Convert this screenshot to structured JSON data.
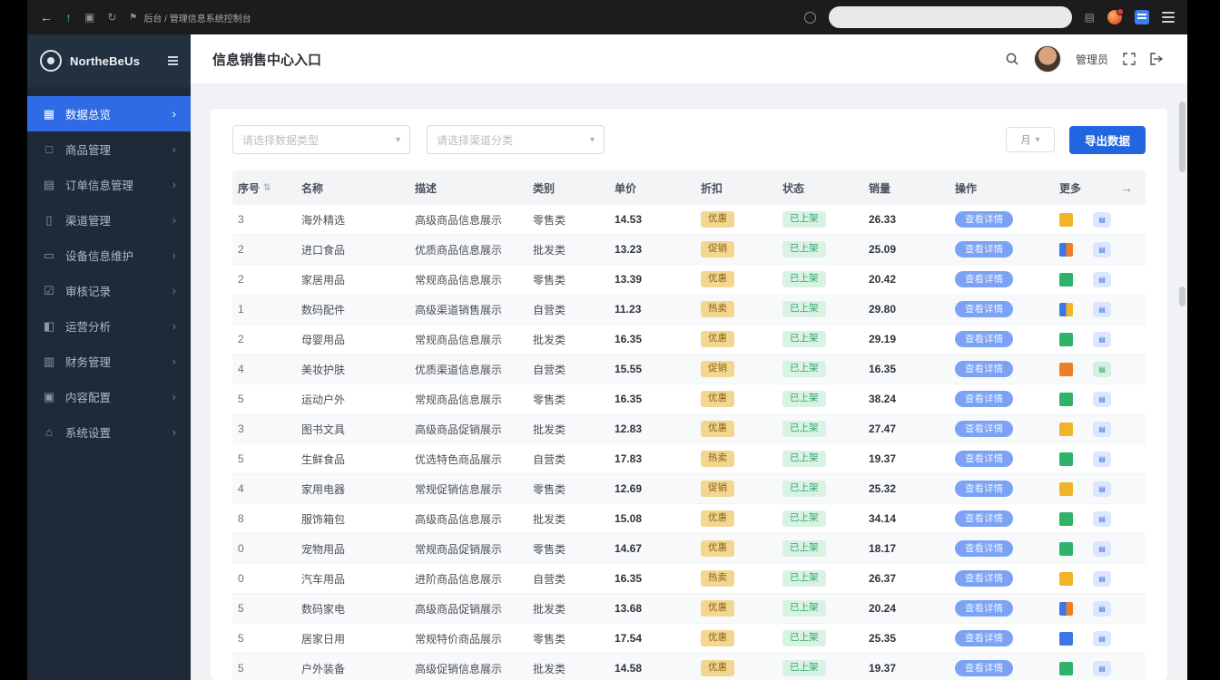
{
  "browser": {
    "address_text": "后台 / 管理信息系统控制台"
  },
  "sidebar": {
    "brand": "NortheBeUs",
    "items": [
      {
        "label": "数据总览",
        "icon": "dashboard-icon",
        "glyph": "▦",
        "active": true
      },
      {
        "label": "商品管理",
        "icon": "products-icon",
        "glyph": "□",
        "active": false
      },
      {
        "label": "订单信息管理",
        "icon": "orders-icon",
        "glyph": "▤",
        "active": false
      },
      {
        "label": "渠道管理",
        "icon": "channel-icon",
        "glyph": "▯",
        "active": false
      },
      {
        "label": "设备信息维护",
        "icon": "devices-icon",
        "glyph": "▭",
        "active": false
      },
      {
        "label": "审核记录",
        "icon": "audit-icon",
        "glyph": "☑",
        "active": false
      },
      {
        "label": "运营分析",
        "icon": "monitor-icon",
        "glyph": "◧",
        "active": false
      },
      {
        "label": "财务管理",
        "icon": "billing-icon",
        "glyph": "▥",
        "active": false
      },
      {
        "label": "内容配置",
        "icon": "schedule-icon",
        "glyph": "▣",
        "active": false
      },
      {
        "label": "系统设置",
        "icon": "home-icon",
        "glyph": "⌂",
        "active": false
      }
    ]
  },
  "topbar": {
    "title": "信息销售中心入口",
    "username": "管理员"
  },
  "toolbar": {
    "filter1_placeholder": "请选择数据类型",
    "filter2_placeholder": "请选择渠道分类",
    "mini_select": "月",
    "primary_button": "导出数据"
  },
  "colors": {
    "accent": "#2e6be5",
    "warning_badge": "#f3d791",
    "success_badge": "#d8f3e3"
  },
  "table": {
    "headers": [
      "序号",
      "名称",
      "描述",
      "类别",
      "单价",
      "折扣",
      "状态",
      "销量",
      "操作",
      "更多"
    ],
    "rows": [
      {
        "idx": "3",
        "name": "海外精选",
        "desc": "高级商品信息展示",
        "cat": "零售类",
        "v1": "14.53",
        "tag1": "优惠",
        "tag2": "已上架",
        "v2": "26.33",
        "action": "查看详情",
        "square": "yellow",
        "btn": "blue"
      },
      {
        "idx": "2",
        "name": "进口食品",
        "desc": "优质商品信息展示",
        "cat": "批发类",
        "v1": "13.23",
        "tag1": "促销",
        "tag2": "已上架",
        "v2": "25.09",
        "action": "查看详情",
        "square": "blue-orange",
        "btn": "blue"
      },
      {
        "idx": "2",
        "name": "家居用品",
        "desc": "常规商品信息展示",
        "cat": "零售类",
        "v1": "13.39",
        "tag1": "优惠",
        "tag2": "已上架",
        "v2": "20.42",
        "action": "查看详情",
        "square": "green",
        "btn": "blue"
      },
      {
        "idx": "1",
        "name": "数码配件",
        "desc": "高级渠道销售展示",
        "cat": "自营类",
        "v1": "11.23",
        "tag1": "热卖",
        "tag2": "已上架",
        "v2": "29.80",
        "action": "查看详情",
        "square": "blue-yellow",
        "btn": "blue"
      },
      {
        "idx": "2",
        "name": "母婴用品",
        "desc": "常规商品信息展示",
        "cat": "批发类",
        "v1": "16.35",
        "tag1": "优惠",
        "tag2": "已上架",
        "v2": "29.19",
        "action": "查看详情",
        "square": "green",
        "btn": "blue"
      },
      {
        "idx": "4",
        "name": "美妆护肤",
        "desc": "优质渠道信息展示",
        "cat": "自营类",
        "v1": "15.55",
        "tag1": "促销",
        "tag2": "已上架",
        "v2": "16.35",
        "action": "查看详情",
        "square": "orange",
        "btn": "green"
      },
      {
        "idx": "5",
        "name": "运动户外",
        "desc": "常规商品信息展示",
        "cat": "零售类",
        "v1": "16.35",
        "tag1": "优惠",
        "tag2": "已上架",
        "v2": "38.24",
        "action": "查看详情",
        "square": "green",
        "btn": "blue"
      },
      {
        "idx": "3",
        "name": "图书文具",
        "desc": "高级商品促销展示",
        "cat": "批发类",
        "v1": "12.83",
        "tag1": "优惠",
        "tag2": "已上架",
        "v2": "27.47",
        "action": "查看详情",
        "square": "yellow",
        "btn": "blue"
      },
      {
        "idx": "5",
        "name": "生鲜食品",
        "desc": "优选特色商品展示",
        "cat": "自营类",
        "v1": "17.83",
        "tag1": "热卖",
        "tag2": "已上架",
        "v2": "19.37",
        "action": "查看详情",
        "square": "green",
        "btn": "blue"
      },
      {
        "idx": "4",
        "name": "家用电器",
        "desc": "常规促销信息展示",
        "cat": "零售类",
        "v1": "12.69",
        "tag1": "促销",
        "tag2": "已上架",
        "v2": "25.32",
        "action": "查看详情",
        "square": "yellow",
        "btn": "blue"
      },
      {
        "idx": "8",
        "name": "服饰箱包",
        "desc": "高级商品信息展示",
        "cat": "批发类",
        "v1": "15.08",
        "tag1": "优惠",
        "tag2": "已上架",
        "v2": "34.14",
        "action": "查看详情",
        "square": "green",
        "btn": "blue"
      },
      {
        "idx": "0",
        "name": "宠物用品",
        "desc": "常规商品促销展示",
        "cat": "零售类",
        "v1": "14.67",
        "tag1": "优惠",
        "tag2": "已上架",
        "v2": "18.17",
        "action": "查看详情",
        "square": "green",
        "btn": "blue"
      },
      {
        "idx": "0",
        "name": "汽车用品",
        "desc": "进阶商品信息展示",
        "cat": "自营类",
        "v1": "16.35",
        "tag1": "热卖",
        "tag2": "已上架",
        "v2": "26.37",
        "action": "查看详情",
        "square": "yellow",
        "btn": "blue"
      },
      {
        "idx": "5",
        "name": "数码家电",
        "desc": "高级商品促销展示",
        "cat": "批发类",
        "v1": "13.68",
        "tag1": "优惠",
        "tag2": "已上架",
        "v2": "20.24",
        "action": "查看详情",
        "square": "blue-orange",
        "btn": "blue"
      },
      {
        "idx": "5",
        "name": "居家日用",
        "desc": "常规特价商品展示",
        "cat": "零售类",
        "v1": "17.54",
        "tag1": "优惠",
        "tag2": "已上架",
        "v2": "25.35",
        "action": "查看详情",
        "square": "blue",
        "btn": "blue"
      },
      {
        "idx": "5",
        "name": "户外装备",
        "desc": "高级促销信息展示",
        "cat": "批发类",
        "v1": "14.58",
        "tag1": "优惠",
        "tag2": "已上架",
        "v2": "19.37",
        "action": "查看详情",
        "square": "green",
        "btn": "blue"
      }
    ]
  }
}
